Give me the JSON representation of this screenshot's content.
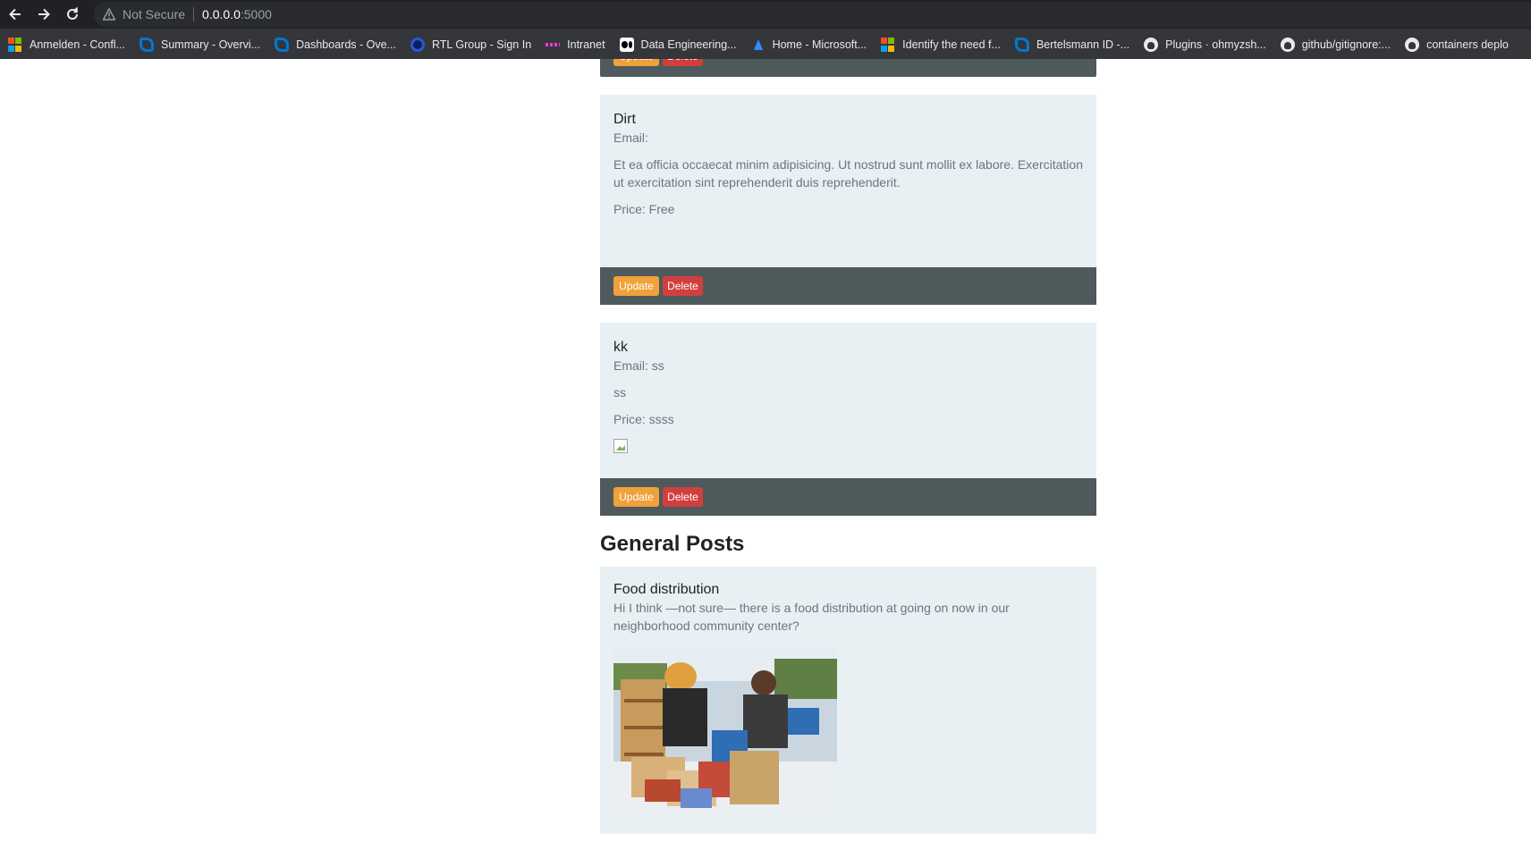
{
  "browser": {
    "security_label": "Not Secure",
    "url_host": "0.0.0.0",
    "url_port": ":5000",
    "bookmarks": [
      {
        "label": "Anmelden - Confl...",
        "icon": "microsoft-icon"
      },
      {
        "label": "Summary - Overvi...",
        "icon": "azure-devops-icon"
      },
      {
        "label": "Dashboards - Ove...",
        "icon": "azure-devops-icon"
      },
      {
        "label": "RTL Group - Sign In",
        "icon": "rtl-icon"
      },
      {
        "label": "Intranet",
        "icon": "intranet-icon"
      },
      {
        "label": "Data Engineering...",
        "icon": "medium-icon"
      },
      {
        "label": "Home - Microsoft...",
        "icon": "azure-icon"
      },
      {
        "label": "Identify the need f...",
        "icon": "microsoft-icon"
      },
      {
        "label": "Bertelsmann ID -...",
        "icon": "azure-devops-icon"
      },
      {
        "label": "Plugins · ohmyzsh...",
        "icon": "github-icon"
      },
      {
        "label": "github/gitignore:...",
        "icon": "github-icon"
      },
      {
        "label": "containers deplo",
        "icon": "github-icon"
      }
    ]
  },
  "posts": [
    {
      "title": "Dirt",
      "email_label": "Email:",
      "description": "Et ea officia occaecat minim adipisicing. Ut nostrud sunt mollit ex labore. Exercitation ut exercitation sint reprehenderit duis reprehenderit.",
      "price_label": "Price: Free",
      "update_label": "Update",
      "delete_label": "Delete"
    },
    {
      "title": "kk",
      "email_label": "Email: ss",
      "description": "ss",
      "price_label": "Price: ssss",
      "update_label": "Update",
      "delete_label": "Delete"
    }
  ],
  "top_card_footer": {
    "update_label": "Update",
    "delete_label": "Delete"
  },
  "general": {
    "heading": "General Posts",
    "posts": [
      {
        "title": "Food distribution",
        "text": "Hi I think —not sure— there is a food distribution at going on now in our neighborhood community center?"
      }
    ]
  },
  "colors": {
    "card_bg": "#e9f0f4",
    "footer_bg": "#4e5a5c",
    "update_btn": "#f0a13a",
    "delete_btn": "#d23e3e"
  }
}
